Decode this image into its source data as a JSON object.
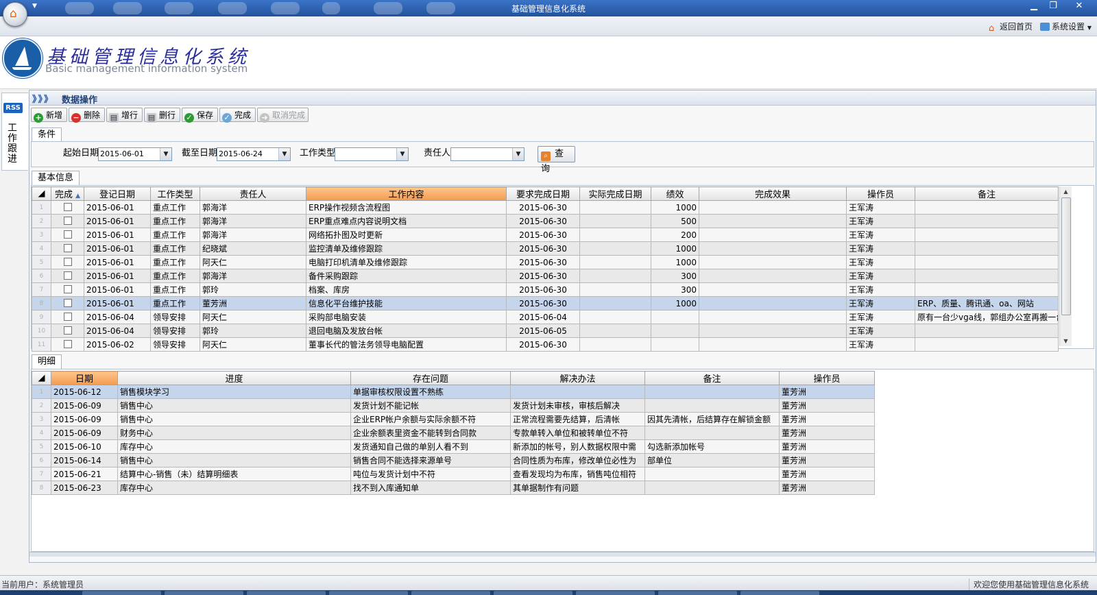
{
  "window": {
    "title": "基础管理信息化系统",
    "minimize": "▁",
    "maximize": "❐",
    "close": "✕"
  },
  "topnav": {
    "home": "返回首页",
    "settings": "系统设置"
  },
  "brand": {
    "cn": "基础管理信息化系统",
    "en": "Basic management information system"
  },
  "sidetab": {
    "rss": "RSS",
    "label": "工作跟进"
  },
  "breadcrumb": {
    "arrows": "》》》",
    "title": "数据操作"
  },
  "toolbar": {
    "add": "新增",
    "delete": "删除",
    "add_row": "增行",
    "delete_row": "删行",
    "save": "保存",
    "complete": "完成",
    "cancel_complete": "取消完成"
  },
  "conditions": {
    "tab": "条件",
    "start_label": "起始日期",
    "start_value": "2015-06-01",
    "end_label": "截至日期",
    "end_value": "2015-06-24",
    "type_label": "工作类型",
    "type_value": "",
    "owner_label": "责任人",
    "owner_value": "",
    "query": "查询"
  },
  "basic": {
    "tab": "基本信息",
    "headers": [
      "完成",
      "登记日期",
      "工作类型",
      "责任人",
      "工作内容",
      "要求完成日期",
      "实际完成日期",
      "绩效",
      "完成效果",
      "操作员",
      "备注"
    ],
    "rows": [
      {
        "n": "1",
        "date": "2015-06-01",
        "type": "重点工作",
        "owner": "郭海洋",
        "content": "ERP操作视频含流程图",
        "due": "2015-06-30",
        "actual": "",
        "score": "1000",
        "effect": "",
        "operator": "王军涛",
        "note": ""
      },
      {
        "n": "2",
        "date": "2015-06-01",
        "type": "重点工作",
        "owner": "郭海洋",
        "content": "ERP重点难点内容说明文档",
        "due": "2015-06-30",
        "actual": "",
        "score": "500",
        "effect": "",
        "operator": "王军涛",
        "note": ""
      },
      {
        "n": "3",
        "date": "2015-06-01",
        "type": "重点工作",
        "owner": "郭海洋",
        "content": "网络拓扑图及时更新",
        "due": "2015-06-30",
        "actual": "",
        "score": "200",
        "effect": "",
        "operator": "王军涛",
        "note": ""
      },
      {
        "n": "4",
        "date": "2015-06-01",
        "type": "重点工作",
        "owner": "纪晓斌",
        "content": "监控清单及维修跟踪",
        "due": "2015-06-30",
        "actual": "",
        "score": "1000",
        "effect": "",
        "operator": "王军涛",
        "note": ""
      },
      {
        "n": "5",
        "date": "2015-06-01",
        "type": "重点工作",
        "owner": "阿天仁",
        "content": "电脑打印机清单及维修跟踪",
        "due": "2015-06-30",
        "actual": "",
        "score": "1000",
        "effect": "",
        "operator": "王军涛",
        "note": ""
      },
      {
        "n": "6",
        "date": "2015-06-01",
        "type": "重点工作",
        "owner": "郭海洋",
        "content": "备件采购跟踪",
        "due": "2015-06-30",
        "actual": "",
        "score": "300",
        "effect": "",
        "operator": "王军涛",
        "note": ""
      },
      {
        "n": "7",
        "date": "2015-06-01",
        "type": "重点工作",
        "owner": "郭玲",
        "content": "档案、库房",
        "due": "2015-06-30",
        "actual": "",
        "score": "300",
        "effect": "",
        "operator": "王军涛",
        "note": ""
      },
      {
        "n": "8",
        "date": "2015-06-01",
        "type": "重点工作",
        "owner": "董芳洲",
        "content": "信息化平台维护技能",
        "due": "2015-06-30",
        "actual": "",
        "score": "1000",
        "effect": "",
        "operator": "王军涛",
        "note": "ERP、质量、腾讯通、oa、网站"
      },
      {
        "n": "9",
        "date": "2015-06-04",
        "type": "领导安排",
        "owner": "阿天仁",
        "content": "采购部电脑安装",
        "due": "2015-06-04",
        "actual": "",
        "score": "",
        "effect": "",
        "operator": "王军涛",
        "note": "原有一台少vga线，郭组办公室再搬一台"
      },
      {
        "n": "10",
        "date": "2015-06-04",
        "type": "领导安排",
        "owner": "郭玲",
        "content": "退回电脑及发放台帐",
        "due": "2015-06-05",
        "actual": "",
        "score": "",
        "effect": "",
        "operator": "王军涛",
        "note": ""
      },
      {
        "n": "11",
        "date": "2015-06-02",
        "type": "领导安排",
        "owner": "阿天仁",
        "content": "董事长代的管法务领导电脑配置",
        "due": "2015-06-30",
        "actual": "",
        "score": "",
        "effect": "",
        "operator": "王军涛",
        "note": ""
      }
    ]
  },
  "detail": {
    "tab": "明细",
    "headers": [
      "日期",
      "进度",
      "存在问题",
      "解决办法",
      "备注",
      "操作员"
    ],
    "rows": [
      {
        "n": "1",
        "date": "2015-06-12",
        "progress": "销售模块学习",
        "issue": "单据审核权限设置不熟练",
        "solution": "",
        "note": "",
        "operator": "董芳洲"
      },
      {
        "n": "2",
        "date": "2015-06-09",
        "progress": "销售中心",
        "issue": "发货计划不能记帐",
        "solution": "发货计划未审核，审核后解决",
        "note": "",
        "operator": "董芳洲"
      },
      {
        "n": "3",
        "date": "2015-06-09",
        "progress": "销售中心",
        "issue": "企业ERP帐户余额与实际余额不符",
        "solution": "正常流程需要先结算，后清帐",
        "note": "因其先清帐，后结算存在解锁金额",
        "operator": "董芳洲"
      },
      {
        "n": "4",
        "date": "2015-06-09",
        "progress": "财务中心",
        "issue": "企业余额表里资金不能转到合同款",
        "solution": "专款单转入单位和被转单位不符",
        "note": "",
        "operator": "董芳洲"
      },
      {
        "n": "5",
        "date": "2015-06-10",
        "progress": "库存中心",
        "issue": "发货通知自己做的单别人看不到",
        "solution": "新添加的帐号，别人数据权限中需",
        "note": "勾选新添加帐号",
        "operator": "董芳洲"
      },
      {
        "n": "6",
        "date": "2015-06-14",
        "progress": "销售中心",
        "issue": "销售合同不能选择来源单号",
        "solution": "合同性质为布库，修改单位必性为",
        "note": "部单位",
        "operator": "董芳洲"
      },
      {
        "n": "7",
        "date": "2015-06-21",
        "progress": "结算中心-销售（未）结算明细表",
        "issue": "吨位与发货计划中不符",
        "solution": "查看发现均为布库，销售吨位相符",
        "note": "",
        "operator": "董芳洲"
      },
      {
        "n": "8",
        "date": "2015-06-23",
        "progress": "库存中心",
        "issue": "找不到入库通知单",
        "solution": "其单据制作有问题",
        "note": "",
        "operator": "董芳洲"
      }
    ]
  },
  "status": {
    "user": "当前用户：系统管理员",
    "welcome": "欢迎您使用基础管理信息化系统"
  }
}
